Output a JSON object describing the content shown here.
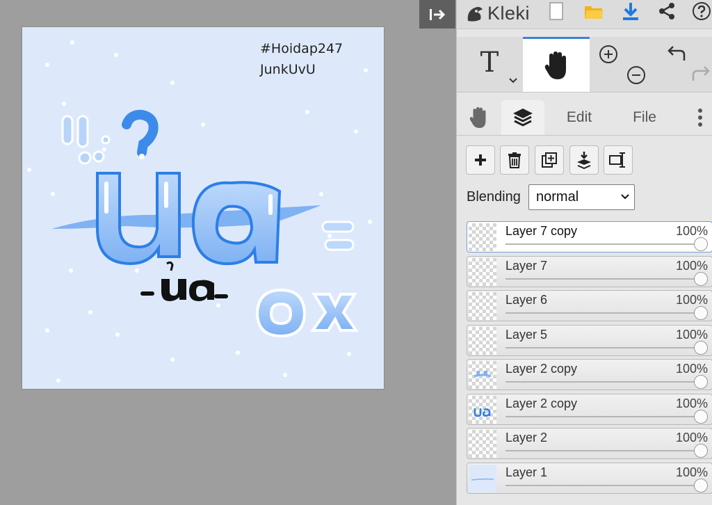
{
  "app": {
    "name": "Kleki"
  },
  "canvas": {
    "watermark_line1": "#Hoidap247",
    "watermark_line2": "JunkUvU",
    "artwork_text_main": "ua",
    "artwork_text_small": "-ua-",
    "artwork_text_ox": "Ox"
  },
  "tools": {
    "text_glyph": "T"
  },
  "tabs": {
    "edit": "Edit",
    "file": "File"
  },
  "blending": {
    "label": "Blending",
    "value": "normal"
  },
  "layers": [
    {
      "name": "Layer 7 copy",
      "opacity": "100%",
      "selected": true
    },
    {
      "name": "Layer 7",
      "opacity": "100%"
    },
    {
      "name": "Layer 6",
      "opacity": "100%"
    },
    {
      "name": "Layer 5",
      "opacity": "100%"
    },
    {
      "name": "Layer 2 copy",
      "opacity": "100%"
    },
    {
      "name": "Layer 2 copy",
      "opacity": "100%"
    },
    {
      "name": "Layer 2",
      "opacity": "100%"
    },
    {
      "name": "Layer 1",
      "opacity": "100%"
    }
  ],
  "colors": {
    "accent": "#3b82d6",
    "canvas_bg": "#dde9fb",
    "workspace": "#9e9e9e"
  }
}
